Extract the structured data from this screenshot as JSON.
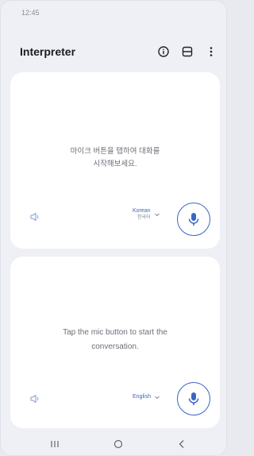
{
  "status_bar": {
    "time": "12:45"
  },
  "header": {
    "title": "Interpreter",
    "icons": [
      "info-icon",
      "split-view-icon",
      "more-options-icon"
    ]
  },
  "top_panel": {
    "prompt_line1": "마이크 버튼을 탭하여 대화를",
    "prompt_line2": "시작해보세요.",
    "language": "Korean",
    "language_native": "한국어"
  },
  "bottom_panel": {
    "prompt_line1": "Tap the mic button to start the",
    "prompt_line2": "conversation.",
    "language": "English"
  },
  "nav": {
    "icons": [
      "recents-icon",
      "home-icon",
      "back-icon"
    ]
  },
  "colors": {
    "accent": "#3a66c4",
    "panel": "#ffffff",
    "background": "#eef0f5"
  }
}
